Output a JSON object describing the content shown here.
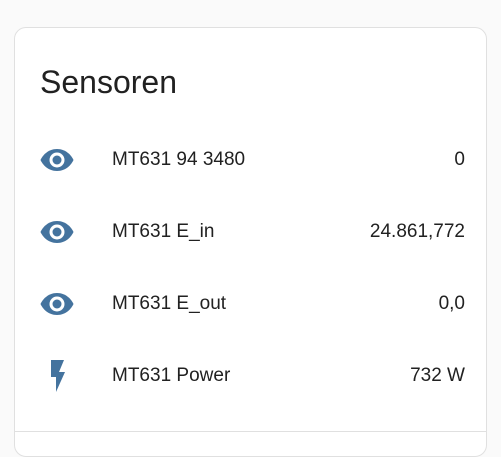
{
  "card": {
    "title": "Sensoren",
    "icon_color": "#44739e",
    "entities": [
      {
        "icon": "eye-icon",
        "name": "MT631 94 3480",
        "value": "0"
      },
      {
        "icon": "eye-icon",
        "name": "MT631 E_in",
        "value": "24.861,772"
      },
      {
        "icon": "eye-icon",
        "name": "MT631 E_out",
        "value": "0,0"
      },
      {
        "icon": "flash-icon",
        "name": "MT631 Power",
        "value": "732 W"
      }
    ]
  }
}
